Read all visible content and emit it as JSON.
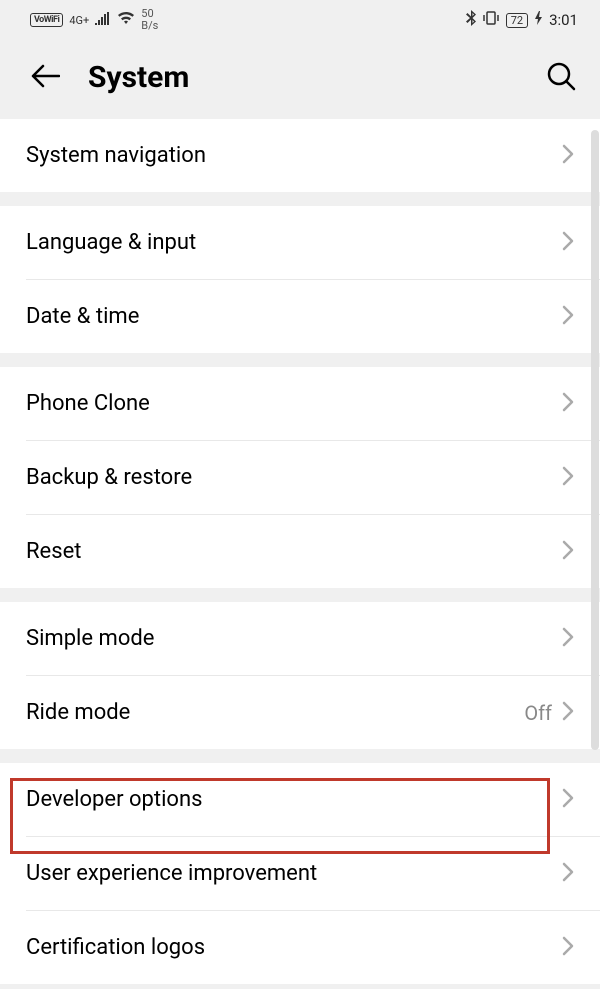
{
  "statusBar": {
    "vowifi": "VoWiFi",
    "network": "4G+",
    "speedValue": "50",
    "speedUnit": "B/s",
    "battery": "72",
    "time": "3:01"
  },
  "header": {
    "title": "System"
  },
  "sections": [
    {
      "rows": [
        {
          "label": "System navigation",
          "value": ""
        }
      ]
    },
    {
      "rows": [
        {
          "label": "Language & input",
          "value": ""
        },
        {
          "label": "Date & time",
          "value": ""
        }
      ]
    },
    {
      "rows": [
        {
          "label": "Phone Clone",
          "value": ""
        },
        {
          "label": "Backup & restore",
          "value": ""
        },
        {
          "label": "Reset",
          "value": ""
        }
      ]
    },
    {
      "rows": [
        {
          "label": "Simple mode",
          "value": ""
        },
        {
          "label": "Ride mode",
          "value": "Off"
        }
      ]
    },
    {
      "rows": [
        {
          "label": "Developer options",
          "value": ""
        },
        {
          "label": "User experience improvement",
          "value": ""
        },
        {
          "label": "Certification logos",
          "value": ""
        }
      ]
    }
  ]
}
